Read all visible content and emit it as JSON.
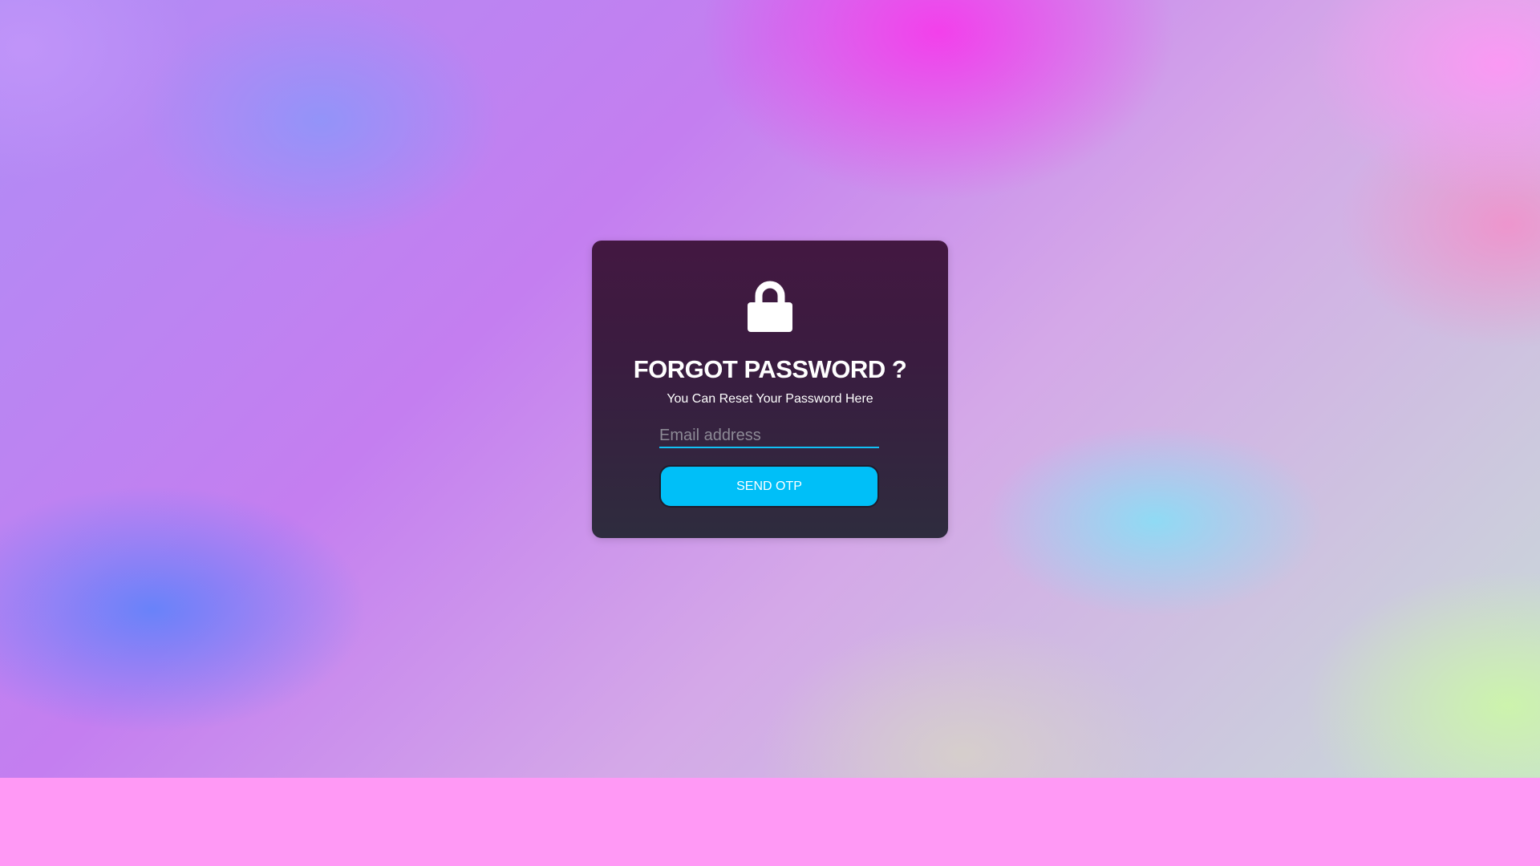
{
  "card": {
    "icon": "lock-icon",
    "title": "FORGOT PASSWORD ?",
    "subtitle": "You Can Reset Your Password Here",
    "email_placeholder": "Email address",
    "email_value": "",
    "send_button_label": "SEND OTP"
  },
  "colors": {
    "accent": "#00bff8",
    "card_top": "#431841",
    "card_bottom": "#2e2c3e",
    "footer": "#ff99f5"
  }
}
